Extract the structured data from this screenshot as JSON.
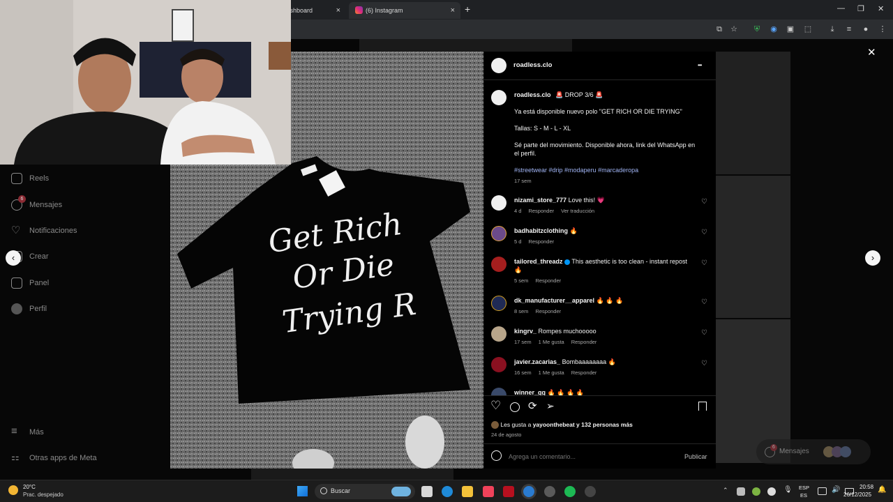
{
  "browser": {
    "tabs": [
      {
        "label": "Dashboard"
      },
      {
        "label": "(6) Instagram"
      }
    ],
    "close_glyph": "×",
    "new_tab_glyph": "+"
  },
  "sidebar": {
    "items": [
      {
        "label": "Reels",
        "icon": "reels-icon"
      },
      {
        "label": "Mensajes",
        "icon": "messenger-icon",
        "badge": "6"
      },
      {
        "label": "Notificaciones",
        "icon": "heart-icon"
      },
      {
        "label": "Crear",
        "icon": "plus-square-icon"
      },
      {
        "label": "Panel",
        "icon": "chart-icon"
      },
      {
        "label": "Perfil",
        "icon": "avatar"
      }
    ],
    "more": "Más",
    "meta_apps": "Otras apps de Meta"
  },
  "post": {
    "username": "roadless.clo",
    "caption_title": "🚨 DROP 3/6 🚨",
    "caption_lines": [
      "Ya está disponible nuevo polo \"GET RICH OR DIE TRYING\"",
      "Tallas: S - M - L - XL",
      "Sé parte del movimiento. Disponible ahora, link del WhatsApp en el perfil."
    ],
    "hashtags": "#streetwear #drip #modaperu #marcaderopa",
    "caption_time": "17 sem",
    "image_text": [
      "Get Rich",
      "Or Die",
      "Trying R"
    ],
    "comments": [
      {
        "user": "nizami_store_777",
        "text": "Love this! 💗",
        "time": "4 d",
        "actions": [
          "Responder",
          "Ver traducción"
        ]
      },
      {
        "user": "badhabitzclothing",
        "text": "🔥",
        "time": "5 d",
        "actions": [
          "Responder"
        ]
      },
      {
        "user": "tailored_threadz",
        "text": "This aesthetic is too clean - instant repost 🔥",
        "time": "5 sem",
        "actions": [
          "Responder"
        ]
      },
      {
        "user": "dk_manufacturer__apparel",
        "text": "🔥 🔥 🔥",
        "time": "8 sem",
        "actions": [
          "Responder"
        ]
      },
      {
        "user": "kingrv_",
        "text": "Rompes muchooooo",
        "time": "17 sem",
        "actions": [
          "1 Me gusta",
          "Responder"
        ]
      },
      {
        "user": "javier.zacarias_",
        "text": "Bombaaaaaaaa 🔥",
        "time": "16 sem",
        "actions": [
          "1 Me gusta",
          "Responder"
        ]
      },
      {
        "user": "winner_gg",
        "text": "🔥 🔥 🔥 🔥",
        "time": "",
        "actions": []
      }
    ],
    "likes_prefix": "Les gusta a ",
    "likes_user": "yayoonthebeat",
    "likes_suffix": " y 132 personas más",
    "date": "24 de agosto",
    "comment_placeholder": "Agrega un comentario...",
    "publish": "Publicar",
    "more_glyph": "•••",
    "close_glyph": "✕"
  },
  "floating_messages": {
    "label": "Mensajes",
    "badge": "6"
  },
  "taskbar": {
    "weather_temp": "20°C",
    "weather_desc": "Prac. despejado",
    "search": "Buscar",
    "lang1": "ESP",
    "lang2": "ES",
    "time": "20:58",
    "date": "26/12/2025"
  },
  "colors": {
    "accent_link": "#a0b4f4",
    "ig_bg": "#000000",
    "verified": "#0095f6",
    "badge": "#ff3040"
  }
}
